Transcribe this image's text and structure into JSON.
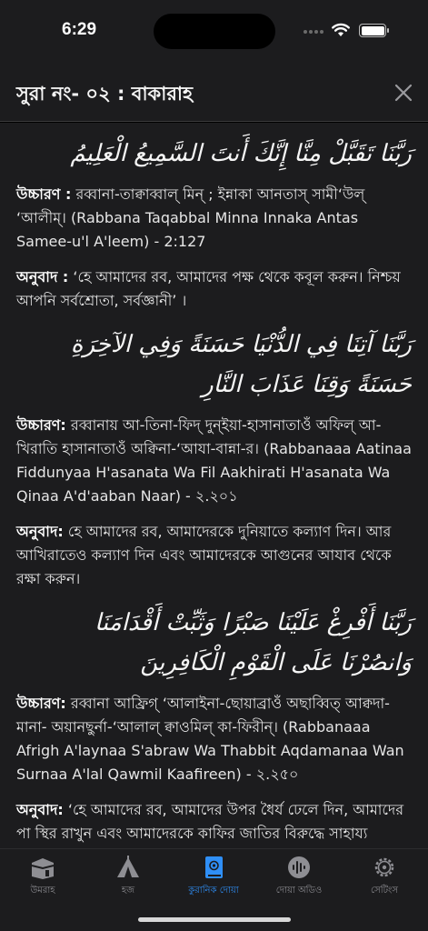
{
  "status_bar": {
    "time": "6:29"
  },
  "header": {
    "title": "সুরা নং- ০২ : বাকারাহ"
  },
  "duas": [
    {
      "arabic": "رَبَّنَا تَقَبَّلْ مِنَّا إِنَّكَ أَنتَ السَّمِيعُ الْعَلِيمُ",
      "pron_label": "উচ্চারণ :",
      "pron_text": "রব্বানা-তাক্বাব্বাল্ মিন্ ; ইন্নাকা আনতাস্ সামী‘উল্ ‘আলীম্। (Rabbana Taqabbal Minna Innaka Antas Samee-u'l A'leem) - 2:127",
      "trans_label": "অনুবাদ :",
      "trans_text": "‘হে আমাদের রব, আমাদের পক্ষ থেকে কবূল করুন। নিশ্চয় আপনি সর্বশ্রোতা, সর্বজ্ঞানী’ ।"
    },
    {
      "arabic": "رَبَّنَا آتِنَا فِي الدُّنْيَا حَسَنَةً وَفِي الآخِرَةِ حَسَنَةً وَقِنَا عَذَابَ النَّارِ",
      "pron_label": "উচ্চারণ:",
      "pron_text": "রব্বানায় আ-তিনা-ফিদ্ দুন্ইয়া-হাসানাতাওঁ অফিল্ আ-খিরাতি হাসানাতাওঁ অক্বিনা-‘আযা-বান্না-র। (Rabbanaaa Aatinaa Fiddunyaa H'asanata Wa Fil Aakhirati H'asanata Wa Qinaa A'd'aaban Naar) - ২.২০১",
      "trans_label": "অনুবাদ:",
      "trans_text": "হে আমাদের রব, আমাদেরকে দুনিয়াতে কল্যাণ দিন। আর আখিরাতেও কল্যাণ দিন এবং আমাদেরকে আগুনের আযাব থেকে রক্ষা করুন।"
    },
    {
      "arabic": "رَبَّنَا أَفْرِغْ عَلَيْنَا صَبْرًا وَثَبِّتْ أَقْدَامَنَا وَانصُرْنَا عَلَى الْقَوْمِ الْكَافِرِينَ",
      "pron_label": "উচ্চারণ:",
      "pron_text": "রব্বানা আফ্রিগ্ ‘আলাইনা-ছোয়াব্রাওঁ অছাব্বিত্ আক্বদা-মানা- অয়ানছুর্না-‘আলাল্ ক্বাওমিল্ কা-ফিরীন্। (Rabbanaaa Afrigh A'laynaa S'abraw Wa Thabbit Aqdamanaa Wan Surnaa A'lal Qawmil Kaafireen) - ২.২৫০",
      "trans_label": "অনুবাদ:",
      "trans_text": "‘হে আমাদের রব, আমাদের উপর ধৈর্য ঢেলে দিন, আমাদের পা স্থির রাখুন এবং আমাদেরকে কাফির জাতির বিরুদ্ধে সাহায্য করুন’।"
    }
  ],
  "tabbar": {
    "tabs": [
      {
        "label": "উমরাহ",
        "icon": "kaaba-icon",
        "active": false
      },
      {
        "label": "হজ",
        "icon": "tent-icon",
        "active": false
      },
      {
        "label": "কুরানিক দোয়া",
        "icon": "quran-book-icon",
        "active": true
      },
      {
        "label": "দোয়া অডিও",
        "icon": "audio-wave-icon",
        "active": false
      },
      {
        "label": "সেটিংস",
        "icon": "gear-icon",
        "active": false
      }
    ],
    "active_color": "#2f8ff7",
    "inactive_color": "#8e8e93"
  }
}
